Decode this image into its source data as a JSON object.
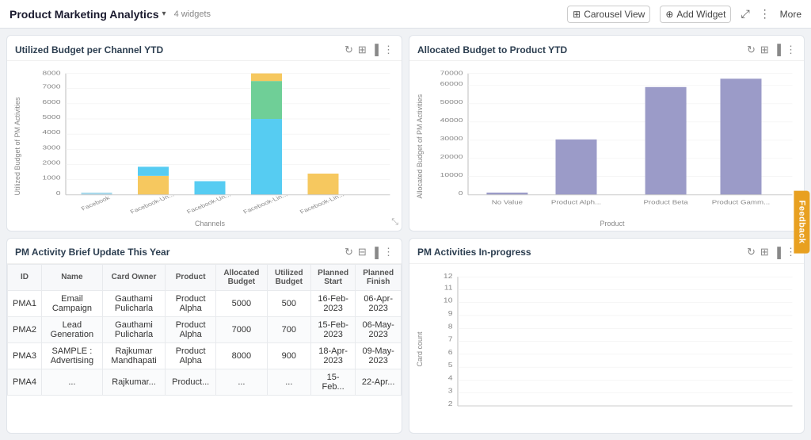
{
  "topbar": {
    "title": "Product Marketing Analytics",
    "arrow": "▾",
    "widgets_label": "4 widgets",
    "carousel_btn": "Carousel View",
    "add_widget_btn": "Add Widget",
    "more_btn": "More"
  },
  "widget1": {
    "title": "Utilized Budget per Channel YTD",
    "y_axis": "Utilized Budget of PM Activities",
    "x_axis": "Channels",
    "bars": [
      {
        "label": "Facebook",
        "segments": [
          {
            "color": "#a8d8ea",
            "value": 100
          }
        ]
      },
      {
        "label": "Facebook-Un...",
        "segments": [
          {
            "color": "#f6c85f",
            "value": 1200
          },
          {
            "color": "#56ccf2",
            "value": 600
          }
        ]
      },
      {
        "label": "Facebook-Un...",
        "segments": [
          {
            "color": "#56ccf2",
            "value": 900
          }
        ]
      },
      {
        "label": "Facebook-Lin...",
        "segments": [
          {
            "color": "#56ccf2",
            "value": 5000
          },
          {
            "color": "#6fcf97",
            "value": 2500
          },
          {
            "color": "#f6c85f",
            "value": 500
          }
        ]
      },
      {
        "label": "Facebook-Lin...",
        "segments": [
          {
            "color": "#f6c85f",
            "value": 1400
          }
        ]
      }
    ],
    "y_ticks": [
      "0",
      "1000",
      "2000",
      "3000",
      "4000",
      "5000",
      "6000",
      "7000",
      "8000"
    ]
  },
  "widget2": {
    "title": "Allocated Budget to Product YTD",
    "y_axis": "Allocated Budget of PM Activities",
    "x_axis": "Product",
    "bars": [
      {
        "label": "No Value",
        "value": 1000,
        "color": "#9b9bc8"
      },
      {
        "label": "Product Alph...",
        "value": 33000,
        "color": "#9b9bc8"
      },
      {
        "label": "Product Beta",
        "value": 63000,
        "color": "#9b9bc8"
      },
      {
        "label": "Product Gamm...",
        "value": 67000,
        "color": "#9b9bc8"
      }
    ],
    "y_ticks": [
      "0",
      "10000",
      "20000",
      "30000",
      "40000",
      "50000",
      "60000",
      "70000"
    ]
  },
  "widget3": {
    "title": "PM Activity Brief Update This Year",
    "table": {
      "headers": [
        "ID",
        "Name",
        "Card Owner",
        "Product",
        "Allocated Budget",
        "Utilized Budget",
        "Planned Start",
        "Planned Finish"
      ],
      "rows": [
        [
          "PMA1",
          "Email Campaign",
          "Gauthami Pulicharla",
          "Product Alpha",
          "5000",
          "500",
          "16-Feb-2023",
          "06-Apr-2023"
        ],
        [
          "PMA2",
          "Lead Generation",
          "Gauthami Pulicharla",
          "Product Alpha",
          "7000",
          "700",
          "15-Feb-2023",
          "06-May-2023"
        ],
        [
          "PMA3",
          "SAMPLE : Advertising",
          "Rajkumar Mandhapati",
          "Product Alpha",
          "8000",
          "900",
          "18-Apr-2023",
          "09-May-2023"
        ],
        [
          "PMA4",
          "...",
          "Rajkumar...",
          "Product...",
          "...",
          "...",
          "15-Feb...",
          "22-Apr..."
        ]
      ]
    }
  },
  "widget4": {
    "title": "PM Activities In-progress",
    "y_axis": "Card count",
    "y_ticks": [
      "2",
      "3",
      "4",
      "5",
      "6",
      "7",
      "8",
      "9",
      "10",
      "11",
      "12"
    ]
  },
  "feedback": "Feedback"
}
